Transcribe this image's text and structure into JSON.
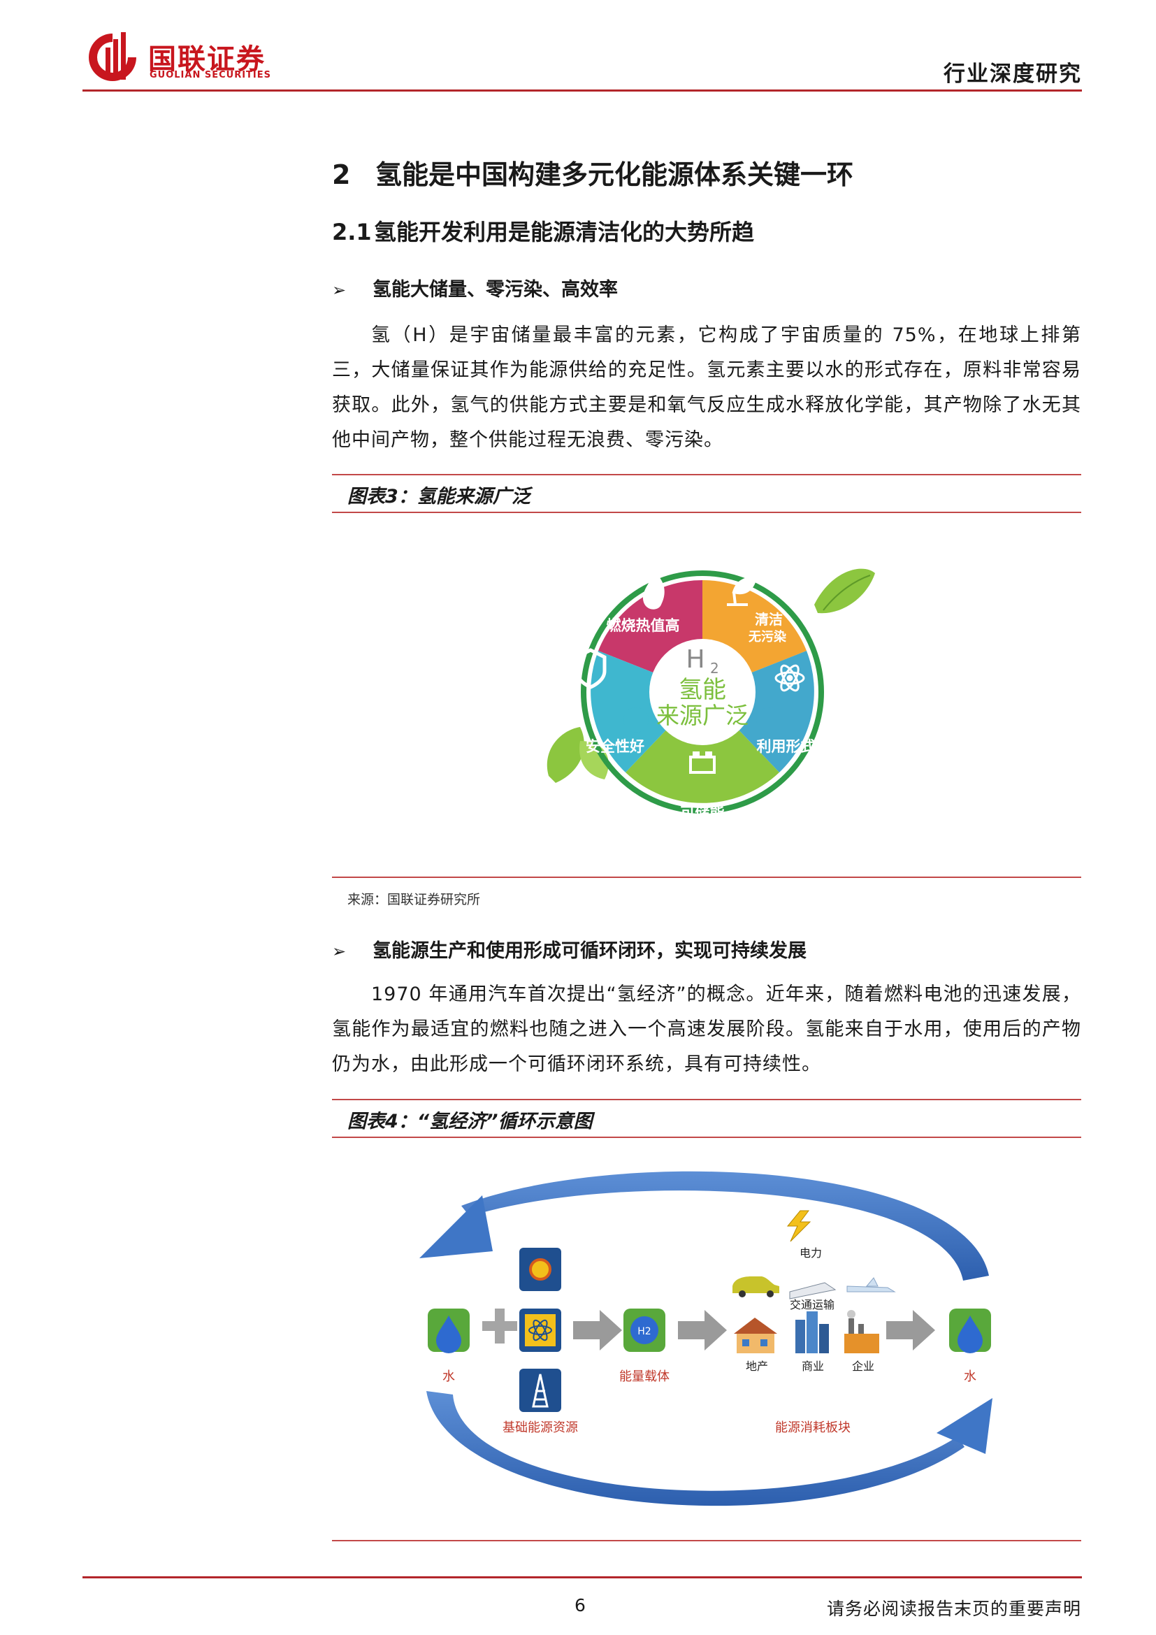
{
  "header": {
    "brand_cn": "国联证券",
    "brand_en": "GUOLIAN SECURITIES",
    "report_type": "行业深度研究"
  },
  "section": {
    "num": "2",
    "title": "氢能是中国构建多元化能源体系关键一环"
  },
  "subsection": {
    "num": "2.1",
    "title": "氢能开发利用是能源清洁化的大势所趋"
  },
  "bullet1": {
    "marker": "➢",
    "title": "氢能大储量、零污染、高效率",
    "paragraph": "氢（H）是宇宙储量最丰富的元素，它构成了宇宙质量的 75%，在地球上排第三，大储量保证其作为能源供给的充足性。氢元素主要以水的形式存在，原料非常容易获取。此外，氢气的供能方式主要是和氧气反应生成水释放化学能，其产物除了水无其他中间产物，整个供能过程无浪费、零污染。"
  },
  "figure3": {
    "title": "图表3：氢能来源广泛",
    "center_h": "H",
    "center_sub": "2",
    "center_line1": "氢能",
    "center_line2": "来源广泛",
    "seg_top_left": "燃烧热值高",
    "seg_top_right_1": "清洁",
    "seg_top_right_2": "无污染",
    "seg_right": "利用形式多",
    "seg_bottom": "可储能",
    "seg_left": "安全性好",
    "colors": {
      "pink": "#c8386a",
      "orange": "#f3a532",
      "teal": "#3fb7cf",
      "green": "#8cc63f",
      "blue": "#43a8cc",
      "ring": "#2e9b48"
    },
    "source": "来源：国联证券研究所"
  },
  "bullet2": {
    "marker": "➢",
    "title": "氢能源生产和使用形成可循环闭环，实现可持续发展",
    "paragraph": "1970 年通用汽车首次提出“氢经济”的概念。近年来，随着燃料电池的迅速发展，氢能作为最适宜的燃料也随之进入一个高速发展阶段。氢能来自于水用，使用后的产物仍为水，由此形成一个可循环闭环系统，具有可持续性。"
  },
  "figure4": {
    "title": "图表4：“氢经济”循环示意图",
    "label_water_left": "水",
    "label_base": "基础能源资源",
    "label_carrier": "能量载体",
    "label_h2": "H2",
    "label_power": "电力",
    "label_transport": "交通运输",
    "label_realestate": "地产",
    "label_commerce": "商业",
    "label_enterprise": "企业",
    "label_consumption": "能源消耗板块",
    "label_water_right": "水",
    "colors": {
      "arrow": "#3f76c6",
      "label": "#c0392b"
    }
  },
  "footer": {
    "page": "6",
    "disclaimer": "请务必阅读报告末页的重要声明"
  }
}
